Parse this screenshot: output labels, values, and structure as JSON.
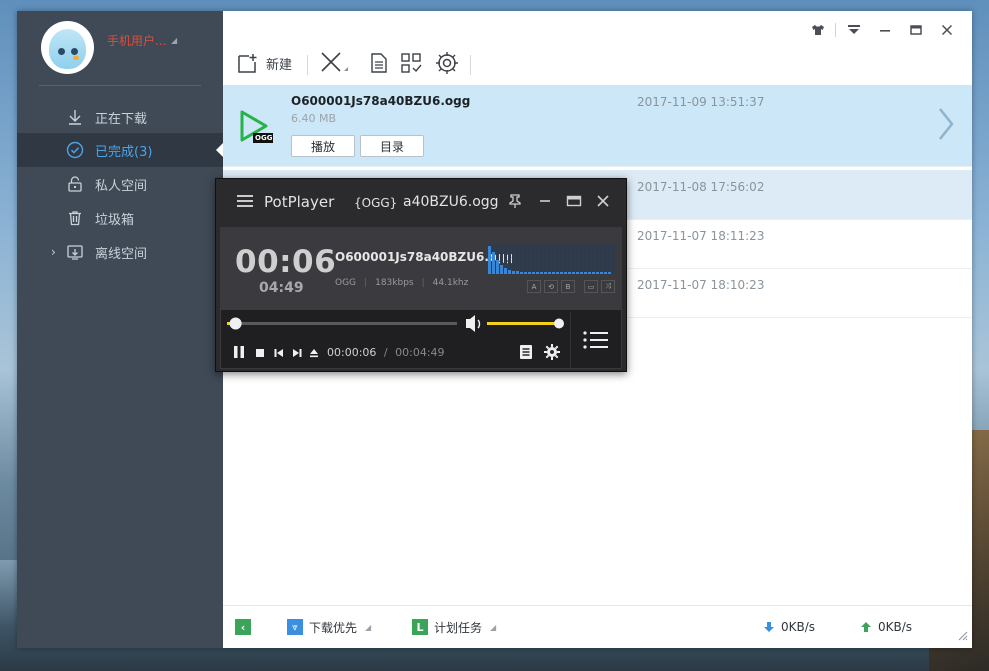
{
  "sidebar": {
    "username": "手机用户...",
    "items": [
      {
        "label": "正在下载",
        "icon": "download-icon"
      },
      {
        "label": "已完成(3)",
        "icon": "check-circle-icon",
        "active": true
      },
      {
        "label": "私人空间",
        "icon": "lock-icon"
      },
      {
        "label": "垃圾箱",
        "icon": "trash-icon"
      },
      {
        "label": "离线空间",
        "icon": "offline-icon",
        "expandable": true
      }
    ]
  },
  "toolbar": {
    "new_label": "新建"
  },
  "files": [
    {
      "name": "O600001Js78a40BZU6.ogg",
      "size": "6.40 MB",
      "date": "2017-11-09 13:51:37",
      "type_badge": "OGG",
      "play_label": "播放",
      "folder_label": "目录"
    },
    {
      "date": "2017-11-08 17:56:02"
    },
    {
      "date": "2017-11-07 18:11:23"
    },
    {
      "date": "2017-11-07 18:10:23"
    }
  ],
  "statusbar": {
    "priority_label": "下载优先",
    "schedule_label": "计划任务",
    "down_speed": "0KB/s",
    "up_speed": "0KB/s"
  },
  "potplayer": {
    "app_name": "PotPlayer",
    "format_tag": "{OGG}",
    "title_file": "a40BZU6.ogg",
    "current_time": "00:06",
    "remaining_time": "04:49",
    "file_name": "O600001Js78a40BZU6.ogg",
    "codec": "OGG",
    "bitrate": "183kbps",
    "sample_rate": "44.1khz",
    "position_time": "00:00:06",
    "separator": "/",
    "duration_time": "00:04:49",
    "seek_fraction": 0.02,
    "volume_fraction": 1.0,
    "mini_buttons": [
      "A",
      "⟲",
      "B",
      "▭",
      "⤨"
    ]
  },
  "colors": {
    "sidebar_bg": "#3f4a56",
    "accent_blue": "#4ea3e6",
    "selected_row": "#cce8f8",
    "username_red": "#e24b3b",
    "potplayer_volume": "#f2d21b",
    "spectrum_blue": "#3a86d6"
  }
}
